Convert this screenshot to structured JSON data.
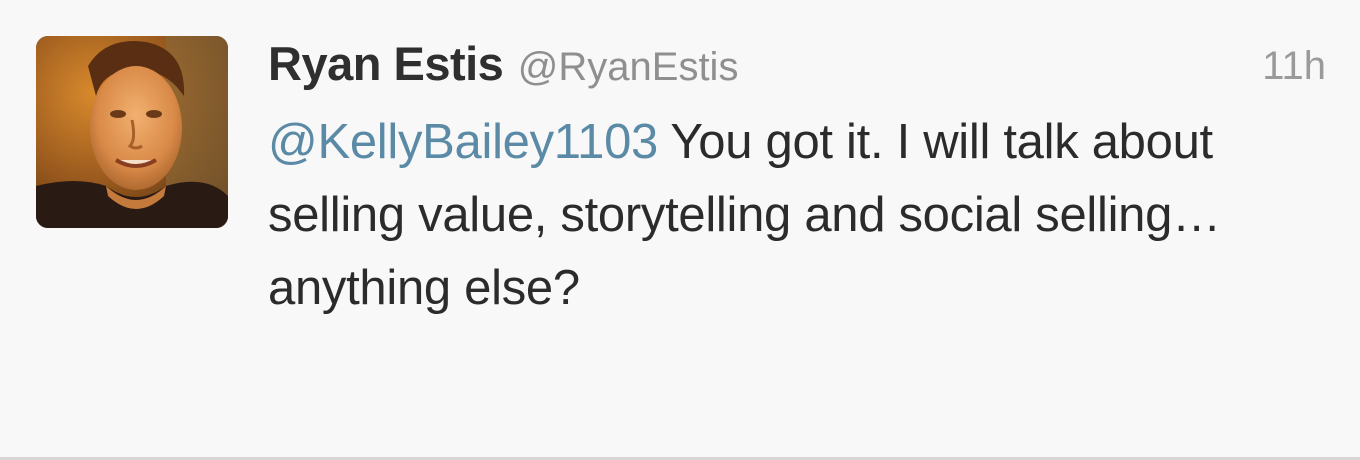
{
  "tweet": {
    "author_name": "Ryan Estis",
    "author_handle": "@RyanEstis",
    "timestamp": "11h",
    "mention": "@KellyBailey1103",
    "body": " You got it. I will talk about selling value, storytelling and social selling…anything else?",
    "avatar_icon": "profile-photo-icon"
  },
  "colors": {
    "background": "#f8f8f8",
    "name": "#2f2f2f",
    "handle": "#8f8f8f",
    "mention": "#5b8aa6",
    "body_text": "#2b2b2b"
  }
}
